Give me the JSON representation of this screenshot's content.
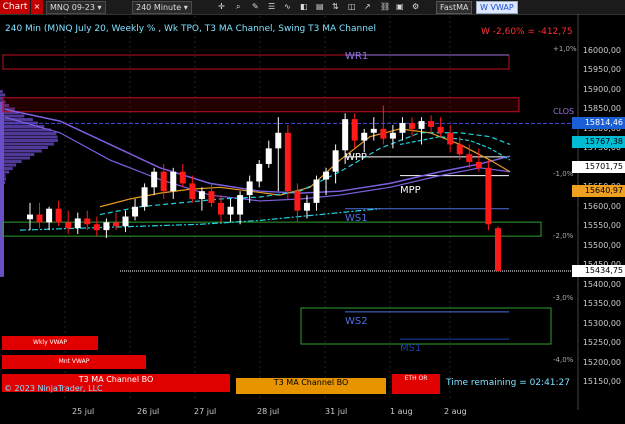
{
  "toolbar": {
    "chart_tab": "Chart",
    "close": "×",
    "instrument": "MNQ 09-23",
    "interval": "240 Minute",
    "fast_ma": "FastMA",
    "vwap": "W VWAP"
  },
  "chart": {
    "title": "240 Min (M)NQ July 20, Weekly % , Wk TPO, T3 MA Channel, Swing T3 MA Channel",
    "change": "W -2,60% = -412,75",
    "copyright": "© 2023 NinjaTrader, LLC",
    "time_remaining": "Time remaining = 02:41:27"
  },
  "levels": {
    "wr1": "WR1",
    "wpp": "WPP",
    "mpp": "MPP",
    "ws1": "WS1",
    "ws2": "WS2",
    "ms1": "MS1",
    "clos": "CLOS"
  },
  "pct_labels": [
    "+1,0%",
    "-1,0%",
    "-2,0%",
    "-3,0%",
    "-4,0%"
  ],
  "bottom_labels": {
    "wkly_vwap": "Wkly VWAP",
    "mnt_vwap": "Mnt VWAP",
    "t3_bo_1": "T3 MA Channel BO",
    "t3_bo_2": "T3 MA Channel BO",
    "eth_or": "ETH OR"
  },
  "y_axis": [
    "16000,00",
    "15950,00",
    "15900,00",
    "15850,00",
    "15800,00",
    "15750,00",
    "15700,00",
    "15650,00",
    "15600,00",
    "15550,00",
    "15500,00",
    "15450,00",
    "15400,00",
    "15350,00",
    "15300,00",
    "15250,00",
    "15200,00",
    "15150,00"
  ],
  "price_tags": [
    {
      "text": "15814,46",
      "bg": "#1a5fd6",
      "fg": "#ffffff"
    },
    {
      "text": "15767,38",
      "bg": "#00bcd4",
      "fg": "#000000"
    },
    {
      "text": "15701,75",
      "bg": "#ffffff",
      "fg": "#000000"
    },
    {
      "text": "15640,97",
      "bg": "#f0a020",
      "fg": "#000000"
    },
    {
      "text": "15434,75",
      "bg": "#ffffff",
      "fg": "#000000"
    }
  ],
  "x_axis": [
    "25 jul",
    "26 jul",
    "27 jul",
    "28 jul",
    "31 jul",
    "1 aug",
    "2 aug"
  ],
  "colors": {
    "bull": "#ffffff",
    "bear": "#ff1a1a",
    "wr1": "#c01020",
    "wpp": "#ffffff",
    "ws1": "#4f4fd0",
    "ws2": "#2fa02f",
    "t3": "#7f5fe0",
    "cyan": "#22d3e0",
    "orange": "#e89a20"
  },
  "candles": [
    {
      "o": 15568,
      "h": 15610,
      "l": 15540,
      "c": 15580
    },
    {
      "o": 15580,
      "h": 15610,
      "l": 15545,
      "c": 15560
    },
    {
      "o": 15560,
      "h": 15600,
      "l": 15540,
      "c": 15595
    },
    {
      "o": 15595,
      "h": 15615,
      "l": 15550,
      "c": 15560
    },
    {
      "o": 15560,
      "h": 15590,
      "l": 15530,
      "c": 15545
    },
    {
      "o": 15545,
      "h": 15585,
      "l": 15530,
      "c": 15570
    },
    {
      "o": 15570,
      "h": 15590,
      "l": 15540,
      "c": 15555
    },
    {
      "o": 15555,
      "h": 15575,
      "l": 15525,
      "c": 15540
    },
    {
      "o": 15540,
      "h": 15570,
      "l": 15520,
      "c": 15560
    },
    {
      "o": 15560,
      "h": 15585,
      "l": 15540,
      "c": 15550
    },
    {
      "o": 15550,
      "h": 15590,
      "l": 15535,
      "c": 15575
    },
    {
      "o": 15575,
      "h": 15620,
      "l": 15565,
      "c": 15600
    },
    {
      "o": 15600,
      "h": 15660,
      "l": 15590,
      "c": 15650
    },
    {
      "o": 15650,
      "h": 15700,
      "l": 15630,
      "c": 15690
    },
    {
      "o": 15690,
      "h": 15710,
      "l": 15620,
      "c": 15640
    },
    {
      "o": 15640,
      "h": 15700,
      "l": 15620,
      "c": 15690
    },
    {
      "o": 15690,
      "h": 15710,
      "l": 15650,
      "c": 15660
    },
    {
      "o": 15660,
      "h": 15680,
      "l": 15610,
      "c": 15620
    },
    {
      "o": 15620,
      "h": 15650,
      "l": 15590,
      "c": 15640
    },
    {
      "o": 15640,
      "h": 15660,
      "l": 15600,
      "c": 15610
    },
    {
      "o": 15610,
      "h": 15630,
      "l": 15560,
      "c": 15580
    },
    {
      "o": 15580,
      "h": 15620,
      "l": 15560,
      "c": 15600
    },
    {
      "o": 15580,
      "h": 15640,
      "l": 15555,
      "c": 15630
    },
    {
      "o": 15630,
      "h": 15680,
      "l": 15610,
      "c": 15665
    },
    {
      "o": 15665,
      "h": 15720,
      "l": 15650,
      "c": 15710
    },
    {
      "o": 15710,
      "h": 15770,
      "l": 15700,
      "c": 15750
    },
    {
      "o": 15750,
      "h": 15830,
      "l": 15640,
      "c": 15790
    },
    {
      "o": 15790,
      "h": 15810,
      "l": 15620,
      "c": 15640
    },
    {
      "o": 15640,
      "h": 15660,
      "l": 15560,
      "c": 15590
    },
    {
      "o": 15590,
      "h": 15630,
      "l": 15570,
      "c": 15610
    },
    {
      "o": 15610,
      "h": 15680,
      "l": 15590,
      "c": 15670
    },
    {
      "o": 15670,
      "h": 15700,
      "l": 15630,
      "c": 15690
    },
    {
      "o": 15690,
      "h": 15760,
      "l": 15660,
      "c": 15745
    },
    {
      "o": 15745,
      "h": 15840,
      "l": 15710,
      "c": 15825
    },
    {
      "o": 15825,
      "h": 15840,
      "l": 15750,
      "c": 15770
    },
    {
      "o": 15770,
      "h": 15800,
      "l": 15740,
      "c": 15790
    },
    {
      "o": 15790,
      "h": 15830,
      "l": 15770,
      "c": 15800
    },
    {
      "o": 15800,
      "h": 15860,
      "l": 15760,
      "c": 15775
    },
    {
      "o": 15775,
      "h": 15810,
      "l": 15750,
      "c": 15790
    },
    {
      "o": 15790,
      "h": 15830,
      "l": 15770,
      "c": 15815
    },
    {
      "o": 15815,
      "h": 15830,
      "l": 15780,
      "c": 15800
    },
    {
      "o": 15800,
      "h": 15830,
      "l": 15760,
      "c": 15820
    },
    {
      "o": 15820,
      "h": 15835,
      "l": 15790,
      "c": 15805
    },
    {
      "o": 15805,
      "h": 15830,
      "l": 15780,
      "c": 15790
    },
    {
      "o": 15790,
      "h": 15810,
      "l": 15740,
      "c": 15760
    },
    {
      "o": 15760,
      "h": 15780,
      "l": 15720,
      "c": 15735
    },
    {
      "o": 15735,
      "h": 15760,
      "l": 15700,
      "c": 15715
    },
    {
      "o": 15715,
      "h": 15750,
      "l": 15690,
      "c": 15700
    },
    {
      "o": 15700,
      "h": 15720,
      "l": 15540,
      "c": 15555
    },
    {
      "o": 15545,
      "h": 15550,
      "l": 15434,
      "c": 15435
    }
  ]
}
